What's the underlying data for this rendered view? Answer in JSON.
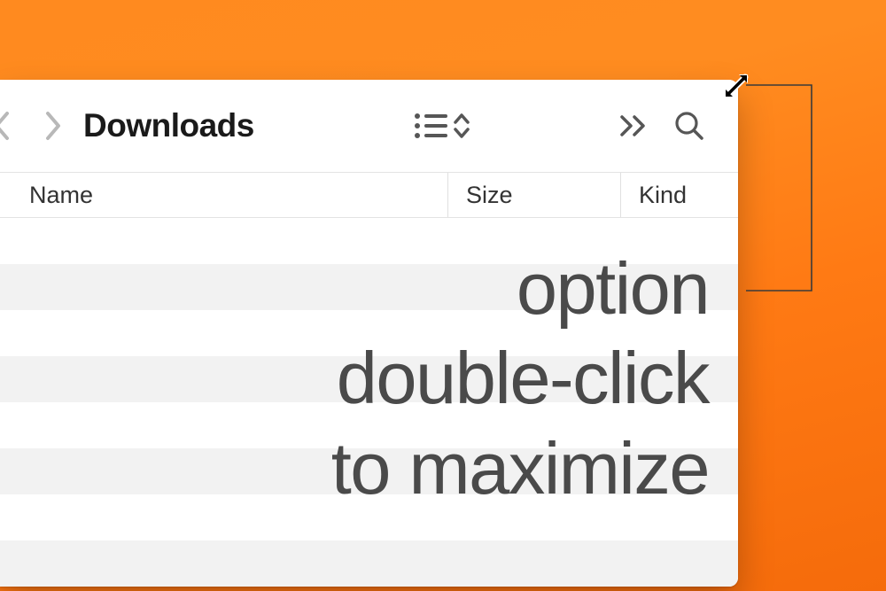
{
  "toolbar": {
    "folder_title": "Downloads"
  },
  "columns": {
    "name": "Name",
    "size": "Size",
    "kind": "Kind"
  },
  "overlay": {
    "line1": "option",
    "line2": "double-click",
    "line3": "to maximize"
  }
}
